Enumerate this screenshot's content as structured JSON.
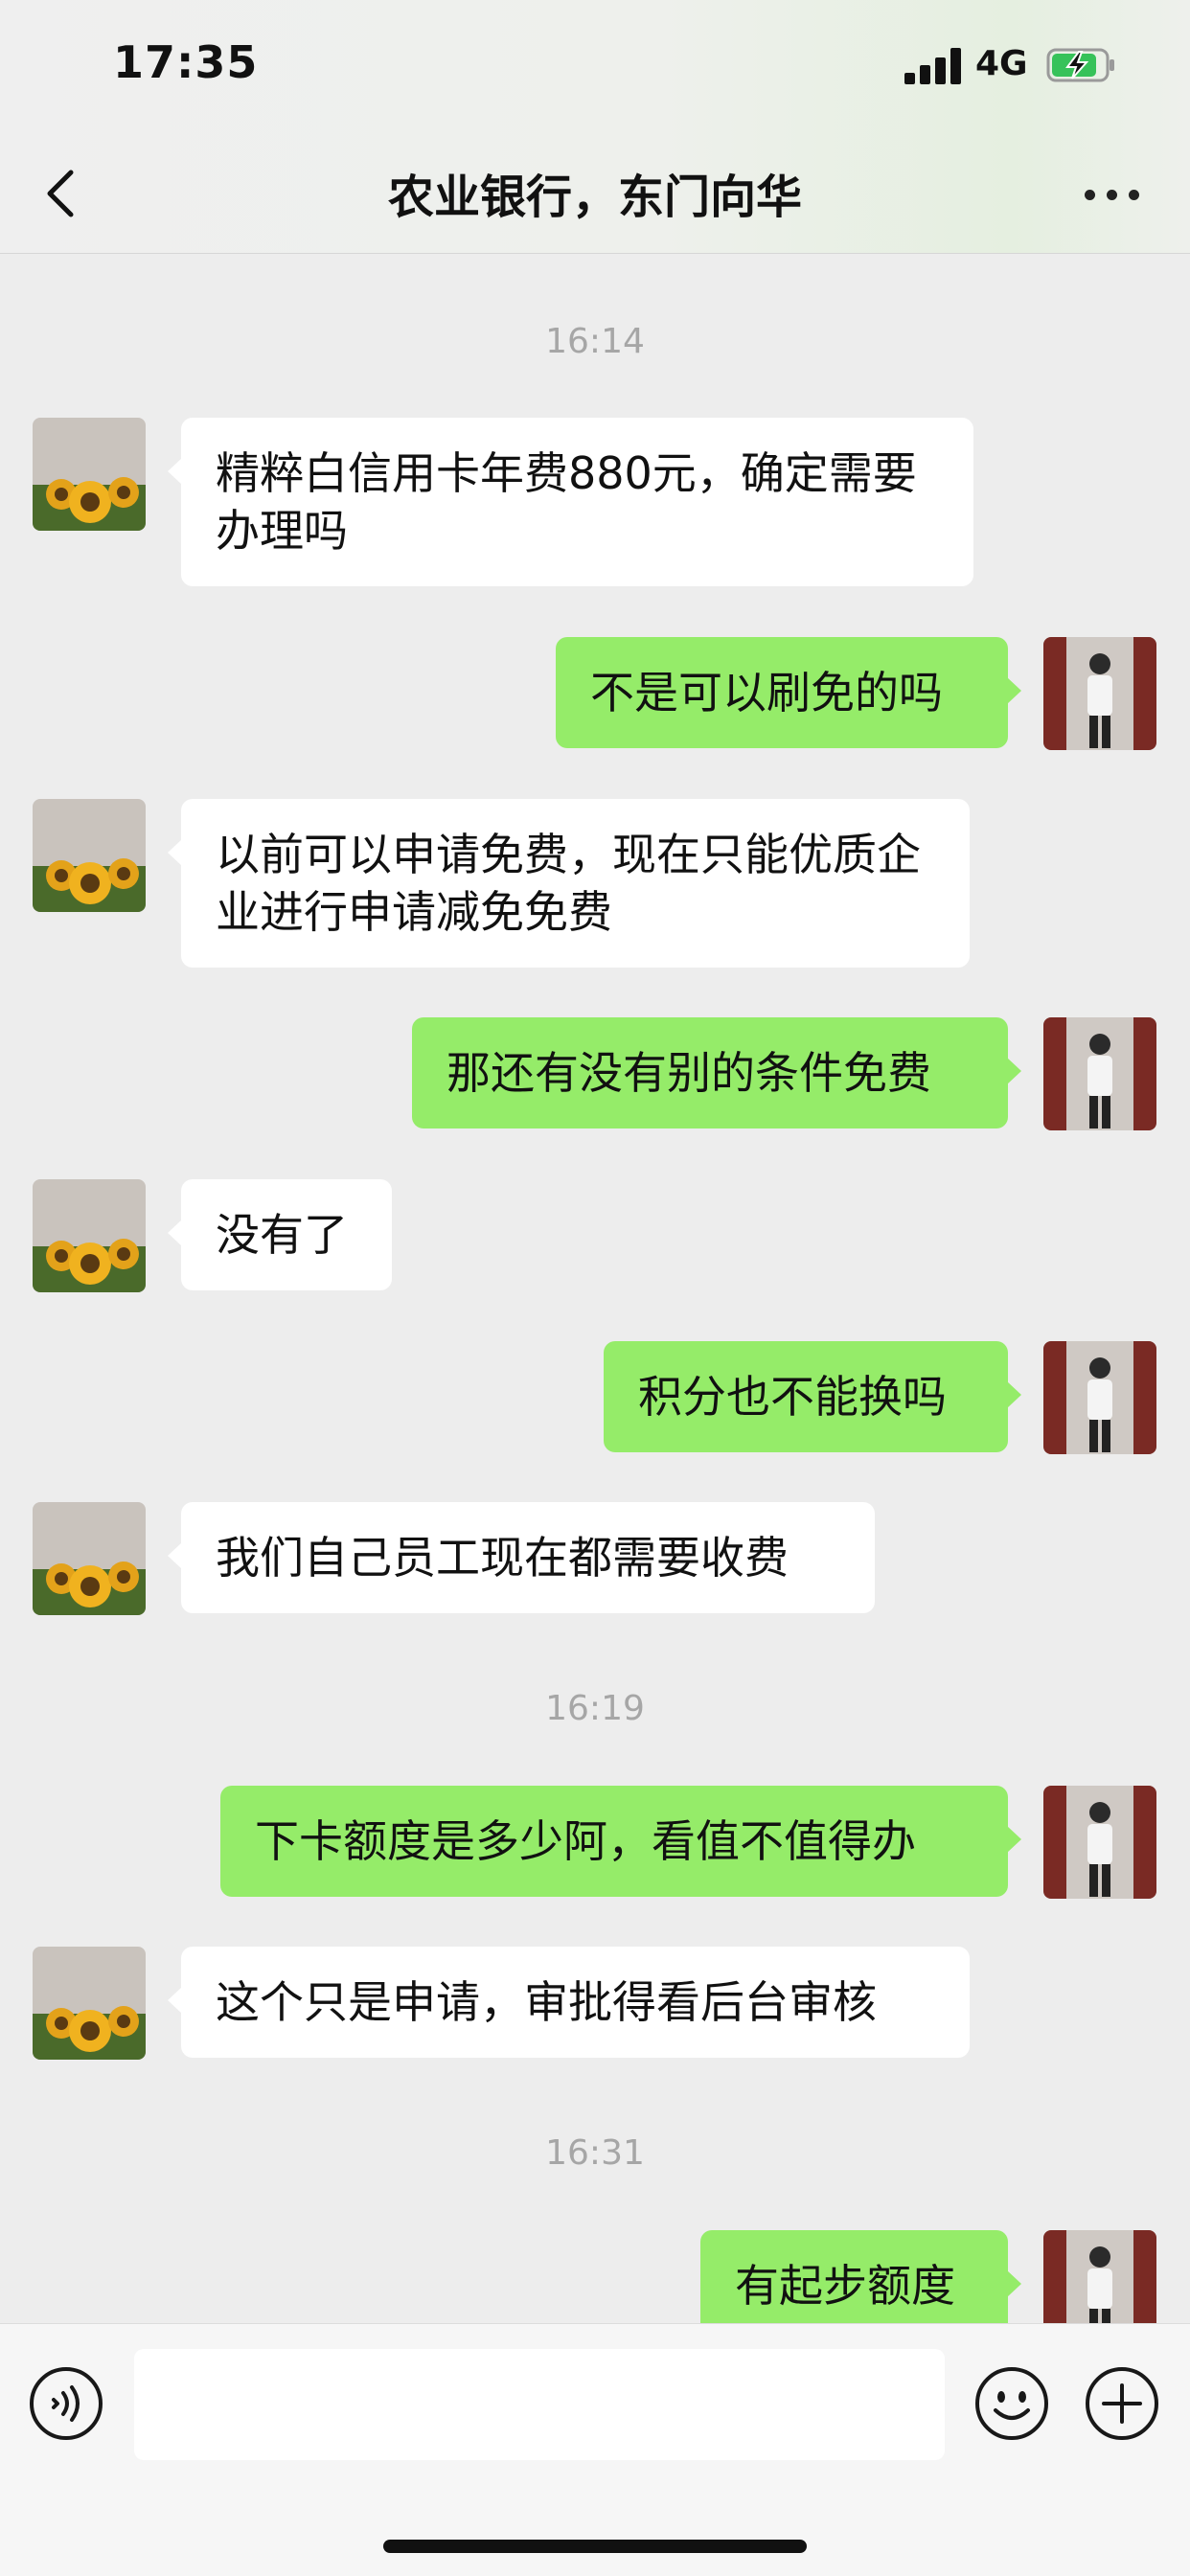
{
  "status_bar": {
    "time": "17:35",
    "network": "4G",
    "icons": [
      "signal-icon",
      "battery-charging-icon"
    ]
  },
  "header": {
    "title": "农业银行，东门向华",
    "icons": [
      "back-chevron-icon",
      "more-dots-icon"
    ]
  },
  "messages": [
    {
      "type": "time",
      "text": "16:14"
    },
    {
      "type": "msg",
      "side": "left",
      "text": "精粹白信用卡年费880元，确定需要办理吗"
    },
    {
      "type": "msg",
      "side": "right",
      "text": "不是可以刷免的吗"
    },
    {
      "type": "msg",
      "side": "left",
      "text": "以前可以申请免费，现在只能优质企业进行申请减免免费"
    },
    {
      "type": "msg",
      "side": "right",
      "text": "那还有没有别的条件免费"
    },
    {
      "type": "msg",
      "side": "left",
      "text": "没有了"
    },
    {
      "type": "msg",
      "side": "right",
      "text": "积分也不能换吗"
    },
    {
      "type": "msg",
      "side": "left",
      "text": "我们自己员工现在都需要收费"
    },
    {
      "type": "time",
      "text": "16:19"
    },
    {
      "type": "msg",
      "side": "right",
      "text": "下卡额度是多少阿，看值不值得办"
    },
    {
      "type": "msg",
      "side": "left",
      "text": "这个只是申请，审批得看后台审核"
    },
    {
      "type": "time",
      "text": "16:31"
    },
    {
      "type": "msg",
      "side": "right",
      "text": "有起步额度"
    }
  ],
  "input_bar": {
    "text_value": "",
    "icons": [
      "voice-icon",
      "emoji-icon",
      "plus-icon"
    ]
  }
}
